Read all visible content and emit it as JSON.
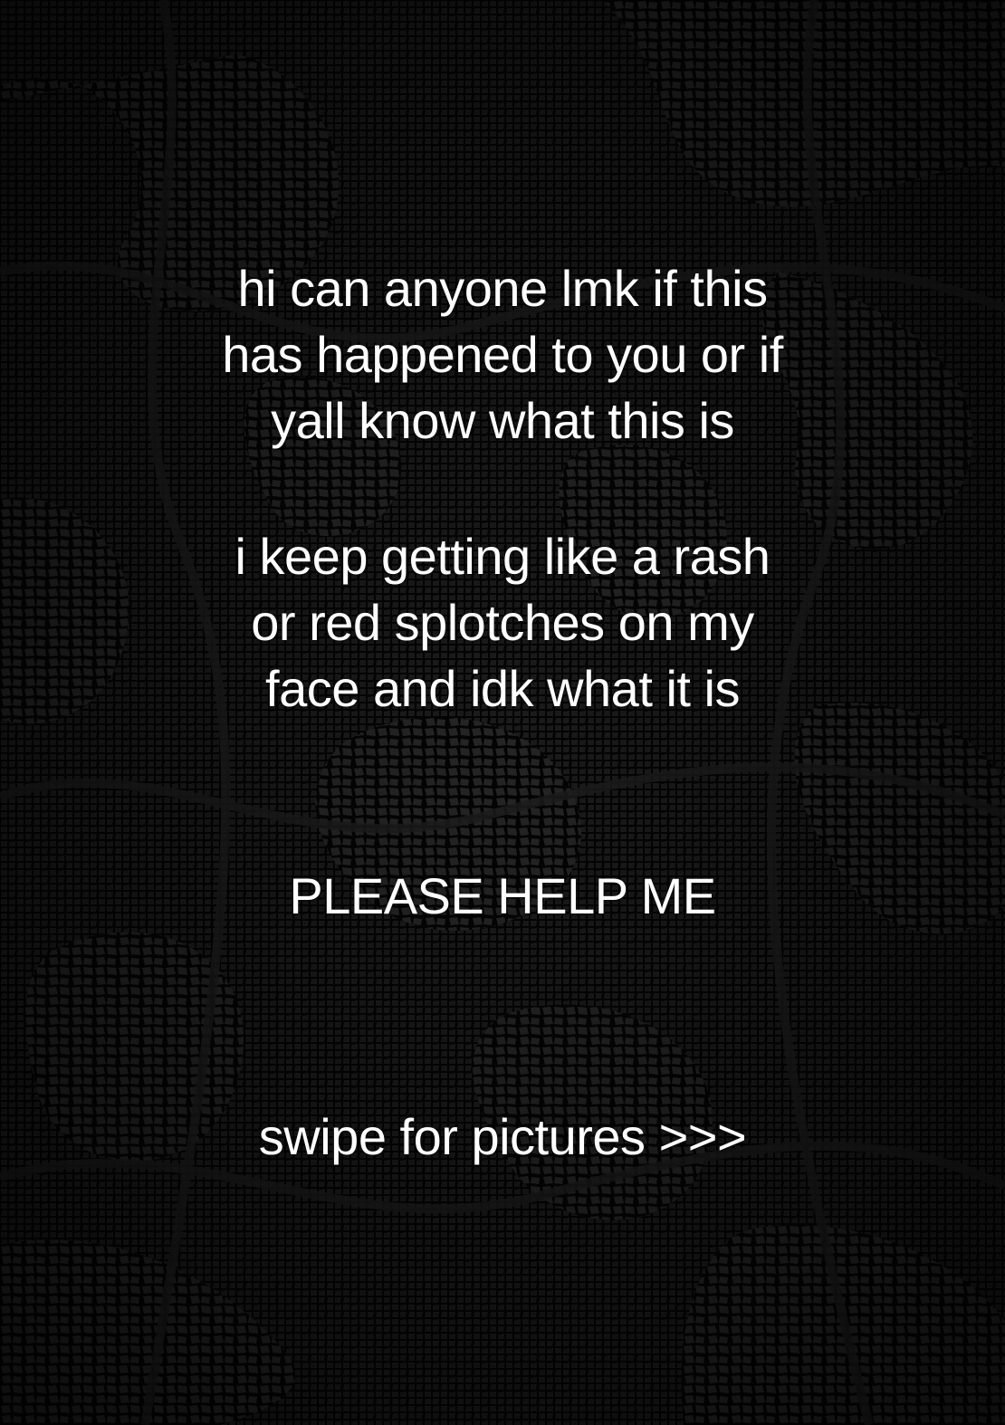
{
  "background": {
    "base_color": "#070707",
    "pattern_color": "#8a8a8a",
    "pattern": "black-lace"
  },
  "caption": {
    "question_lines": [
      "hi can anyone lmk if this",
      "has happened to you or if",
      "yall know what this is"
    ],
    "rash_lines": [
      "i keep getting like a rash",
      "or red splotches on my",
      "face and idk what it is"
    ],
    "help": "PLEASE HELP ME",
    "swipe": "swipe for pictures >>>"
  }
}
